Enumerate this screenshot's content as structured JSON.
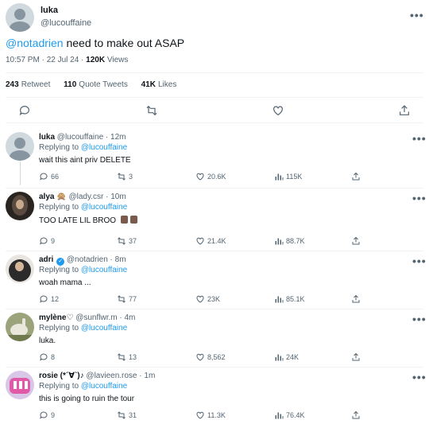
{
  "main_tweet": {
    "name": "luka",
    "handle": "@lucouffaine",
    "mention": "@notadrien",
    "text": "need to make out ASAP",
    "time": "10:57 PM · 22 Jul 24 ·",
    "views_count": "120K",
    "views_label": "Views",
    "retweets_count": "243",
    "retweets_label": "Retweet",
    "quotes_count": "110",
    "quotes_label": "Quote Tweets",
    "likes_count": "41K",
    "likes_label": "Likes"
  },
  "replies": [
    {
      "name": "luka",
      "handle": "@lucouffaine · 12m",
      "replying_label": "Replying to",
      "replying_to": "@lucouffaine",
      "text": "wait this aint priv DELETE",
      "comments": "66",
      "retweets": "3",
      "likes": "20.6K",
      "views": "115K"
    },
    {
      "name": "alya 🙊",
      "handle": "@lady.csr · 10m",
      "replying_label": "Replying to",
      "replying_to": "@lucouffaine",
      "text": "TOO LATE LIL BROO",
      "comments": "9",
      "retweets": "37",
      "likes": "21.4K",
      "views": "88.7K"
    },
    {
      "name": "adri",
      "handle": "@notadrien · 8m",
      "replying_label": "Replying to",
      "replying_to": "@lucouffaine",
      "text": "woah mama ...",
      "comments": "12",
      "retweets": "77",
      "likes": "23K",
      "views": "85.1K"
    },
    {
      "name": "mylène♡",
      "handle": "@sunflwr.m · 4m",
      "replying_label": "Replying to",
      "replying_to": "@lucouffaine",
      "text": "luka.",
      "comments": "8",
      "retweets": "13",
      "likes": "8,562",
      "views": "24K"
    },
    {
      "name": "rosie (*´∀`)♪",
      "handle": "@lavieen.rose · 1m",
      "replying_label": "Replying to",
      "replying_to": "@lucouffaine",
      "text": "this is going to ruin the tour",
      "comments": "9",
      "retweets": "31",
      "likes": "11.3K",
      "views": "76.4K"
    }
  ],
  "more_glyph": "•••",
  "colors": {
    "accent": "#1d9bf0",
    "muted": "#536471",
    "divider": "#eff3f4"
  }
}
